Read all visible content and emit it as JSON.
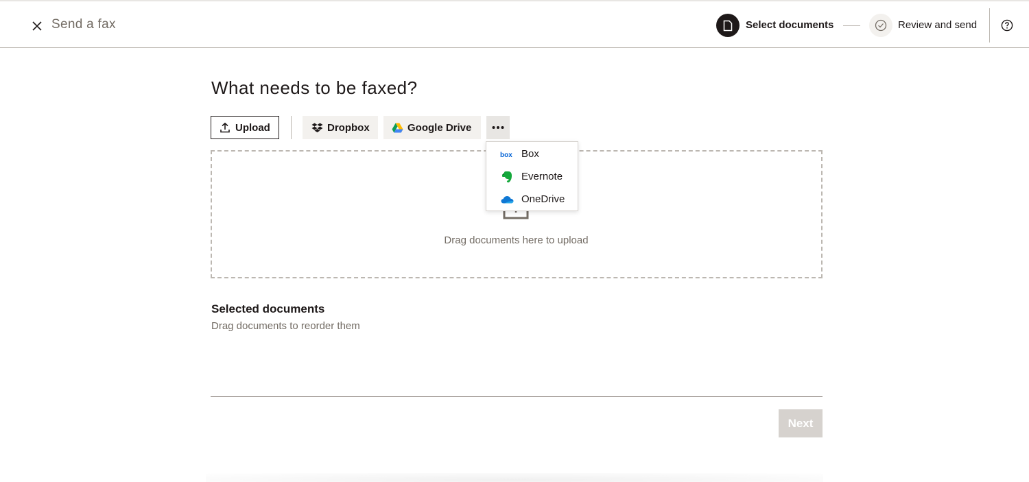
{
  "header": {
    "title": "Send a fax",
    "close_icon": "close-icon",
    "help_icon": "help-circle-icon",
    "steps": [
      {
        "label": "Select documents",
        "icon": "document-icon",
        "state": "active"
      },
      {
        "label": "Review and send",
        "icon": "check-circle-icon",
        "state": "pending"
      }
    ]
  },
  "main": {
    "heading": "What needs to be faxed?",
    "sources": {
      "upload_label": "Upload",
      "dropbox_label": "Dropbox",
      "gdrive_label": "Google Drive",
      "more_icon": "more-horizontal-icon"
    },
    "more_menu": [
      {
        "label": "Box",
        "icon": "box-logo-icon",
        "icon_text": "box"
      },
      {
        "label": "Evernote",
        "icon": "evernote-logo-icon"
      },
      {
        "label": "OneDrive",
        "icon": "onedrive-logo-icon"
      }
    ],
    "dropzone": {
      "text": "Drag documents here to upload"
    },
    "selected": {
      "title": "Selected documents",
      "subtitle": "Drag documents to reorder them"
    },
    "next_label": "Next"
  },
  "colors": {
    "ink": "#1e1919",
    "muted": "#736c64",
    "surface": "#f3f1ee",
    "disabled": "#d6d2ce",
    "box_blue": "#0061d5",
    "evernote_green": "#14a83b",
    "onedrive_blue": "#0f78d4"
  }
}
